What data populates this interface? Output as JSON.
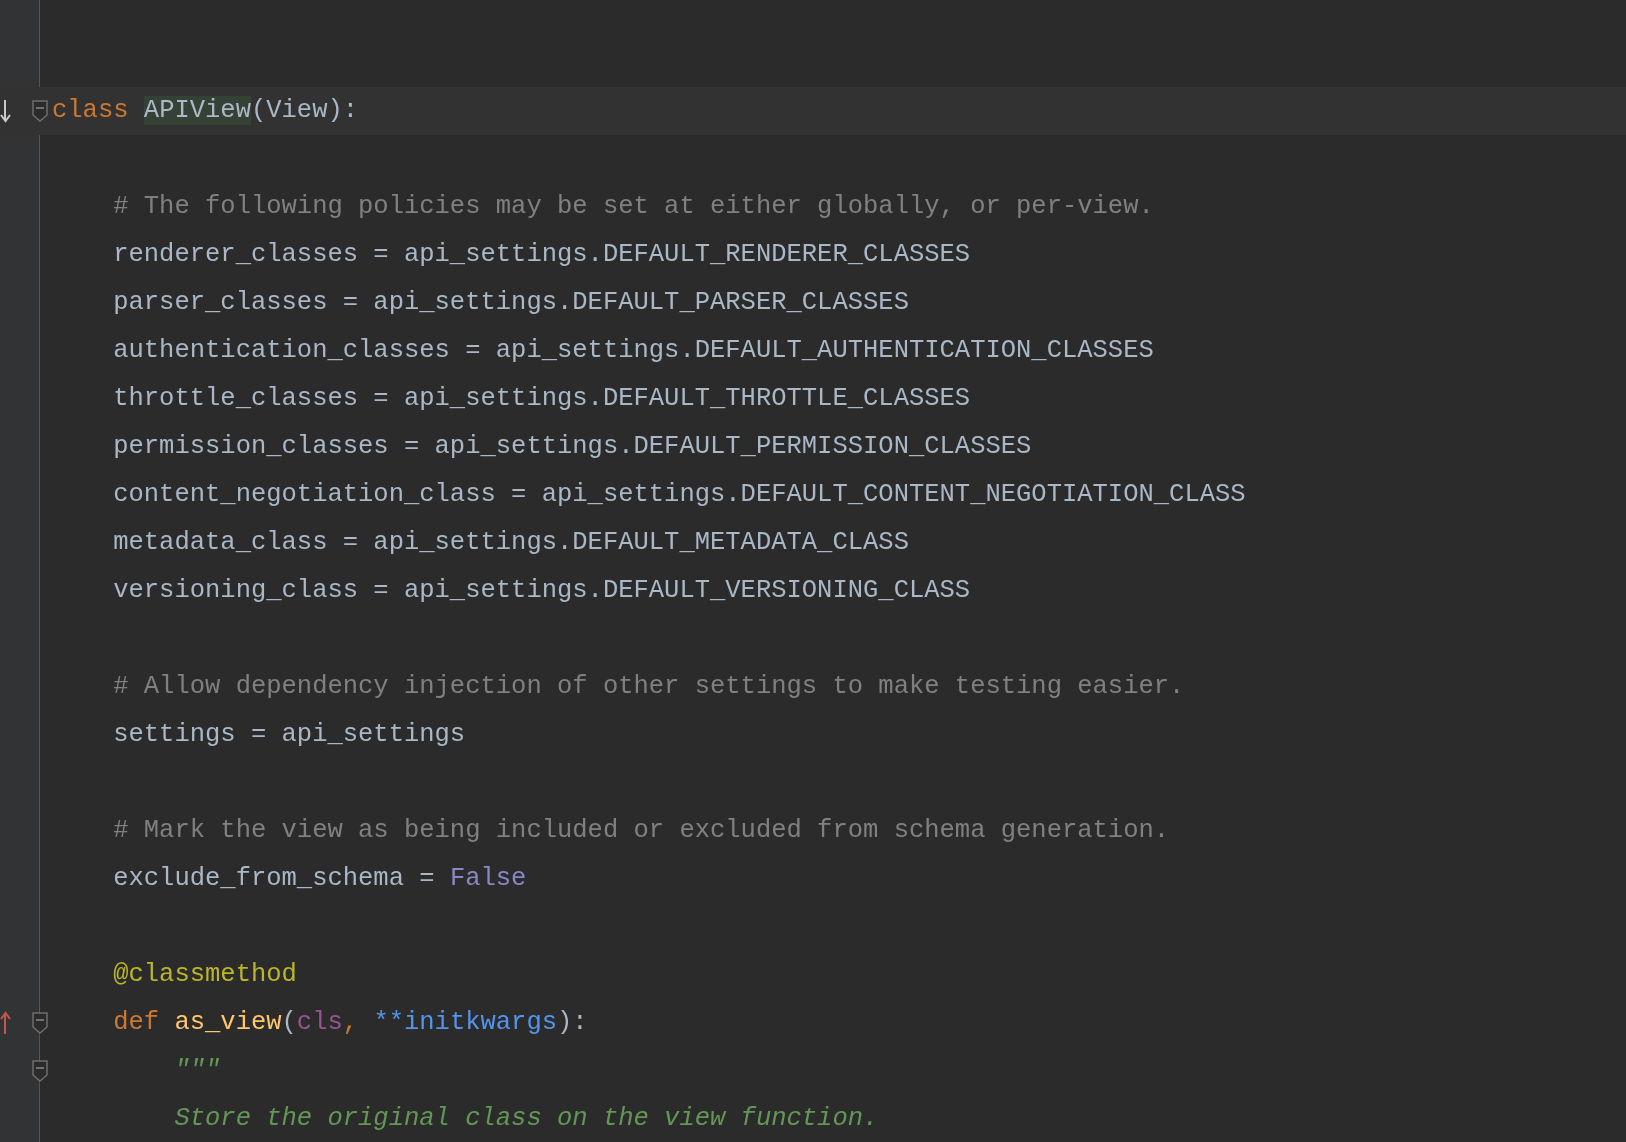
{
  "editor": {
    "lines": [
      {
        "kind": "implements",
        "current": true,
        "fold": true,
        "tokens": [
          {
            "text": "class ",
            "kind": "keyword"
          },
          {
            "text": "APIView",
            "kind": "match"
          },
          {
            "text": "(View):",
            "kind": "plain"
          }
        ]
      },
      {
        "kind": "plain",
        "current": false,
        "fold": false
      },
      {
        "kind": "plain",
        "current": false,
        "fold": false,
        "tokens": [
          {
            "text": "    # The following policies may be set at either globally, or per-view.",
            "kind": "comment"
          }
        ]
      },
      {
        "kind": "plain",
        "current": false,
        "fold": false,
        "tokens": [
          {
            "text": "    renderer_classes = api_settings.DEFAULT_RENDERER_CLASSES",
            "kind": "plain"
          }
        ]
      },
      {
        "kind": "plain",
        "current": false,
        "fold": false,
        "tokens": [
          {
            "text": "    parser_classes = api_settings.DEFAULT_PARSER_CLASSES",
            "kind": "plain"
          }
        ]
      },
      {
        "kind": "plain",
        "current": false,
        "fold": false,
        "tokens": [
          {
            "text": "    authentication_classes = api_settings.DEFAULT_AUTHENTICATION_CLASSES",
            "kind": "plain"
          }
        ]
      },
      {
        "kind": "plain",
        "current": false,
        "fold": false,
        "tokens": [
          {
            "text": "    throttle_classes = api_settings.DEFAULT_THROTTLE_CLASSES",
            "kind": "plain"
          }
        ]
      },
      {
        "kind": "plain",
        "current": false,
        "fold": false,
        "tokens": [
          {
            "text": "    permission_classes = api_settings.DEFAULT_PERMISSION_CLASSES",
            "kind": "plain"
          }
        ]
      },
      {
        "kind": "plain",
        "current": false,
        "fold": false,
        "tokens": [
          {
            "text": "    content_negotiation_class = api_settings.DEFAULT_CONTENT_NEGOTIATION_CLASS",
            "kind": "plain"
          }
        ]
      },
      {
        "kind": "plain",
        "current": false,
        "fold": false,
        "tokens": [
          {
            "text": "    metadata_class = api_settings.DEFAULT_METADATA_CLASS",
            "kind": "plain"
          }
        ]
      },
      {
        "kind": "plain",
        "current": false,
        "fold": false,
        "tokens": [
          {
            "text": "    versioning_class = api_settings.DEFAULT_VERSIONING_CLASS",
            "kind": "plain"
          }
        ]
      },
      {
        "kind": "plain",
        "current": false,
        "fold": false
      },
      {
        "kind": "plain",
        "current": false,
        "fold": false,
        "tokens": [
          {
            "text": "    # Allow dependency injection of other settings to make testing easier.",
            "kind": "comment"
          }
        ]
      },
      {
        "kind": "plain",
        "current": false,
        "fold": false,
        "tokens": [
          {
            "text": "    settings = api_settings",
            "kind": "plain"
          }
        ]
      },
      {
        "kind": "plain",
        "current": false,
        "fold": false
      },
      {
        "kind": "plain",
        "current": false,
        "fold": false,
        "tokens": [
          {
            "text": "    # Mark the view as being included or excluded from schema generation.",
            "kind": "comment"
          }
        ]
      },
      {
        "kind": "plain",
        "current": false,
        "fold": false,
        "tokens": [
          {
            "text": "    exclude_from_schema = ",
            "kind": "plain"
          },
          {
            "text": "False",
            "kind": "constant"
          }
        ]
      },
      {
        "kind": "plain",
        "current": false,
        "fold": false
      },
      {
        "kind": "plain",
        "current": false,
        "fold": false,
        "tokens": [
          {
            "text": "    @classmethod",
            "kind": "decorator"
          }
        ]
      },
      {
        "kind": "overridden",
        "current": false,
        "fold": true,
        "tokens": [
          {
            "text": "    def ",
            "kind": "keyword"
          },
          {
            "text": "as_view",
            "kind": "function"
          },
          {
            "text": "(",
            "kind": "plain"
          },
          {
            "text": "cls",
            "kind": "self"
          },
          {
            "text": ", ",
            "kind": "keyword"
          },
          {
            "text": "**initkwargs",
            "kind": "param"
          },
          {
            "text": "):",
            "kind": "plain"
          }
        ]
      },
      {
        "kind": "plain",
        "current": false,
        "fold": true,
        "tokens": [
          {
            "text": "        \"\"\"",
            "kind": "docstring"
          }
        ]
      },
      {
        "kind": "plain",
        "current": false,
        "fold": false,
        "tokens": [
          {
            "text": "        Store the original class on the view function.",
            "kind": "docstring"
          }
        ]
      }
    ]
  }
}
